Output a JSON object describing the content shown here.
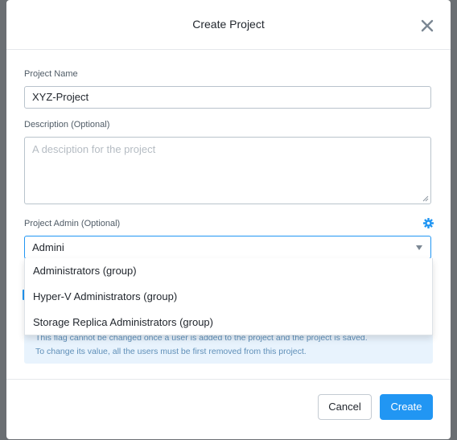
{
  "dialog": {
    "title": "Create Project",
    "close_icon": "close-icon"
  },
  "form": {
    "project_name": {
      "label": "Project Name",
      "value": "XYZ-Project"
    },
    "description": {
      "label": "Description (Optional)",
      "placeholder": "A desciption for the project"
    },
    "project_admin": {
      "label": "Project Admin (Optional)",
      "settings_icon": "gear-icon",
      "value": "Admini",
      "options": [
        "Administrators (group)",
        "Hyper-V Administrators (group)",
        "Storage Replica Administrators (group)"
      ]
    },
    "info_text": [
      "This flag cannot be changed once a user is added to the project and the project is saved.",
      "To change its value, all the users must be first removed from this project."
    ]
  },
  "footer": {
    "cancel_label": "Cancel",
    "create_label": "Create"
  },
  "colors": {
    "accent": "#2196f3",
    "info_bg": "#e8f3fd",
    "overlay": "#6b6f73"
  }
}
